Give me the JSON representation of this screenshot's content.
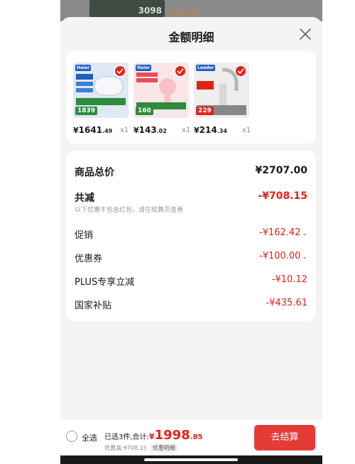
{
  "background": {
    "price_hint": "3098",
    "badge_text": "30天价保"
  },
  "sheet": {
    "title": "金额明细",
    "close_icon": "close-icon"
  },
  "products": [
    {
      "brand": "Haier",
      "tag": "1839",
      "price_symbol": "¥",
      "price_int": "1641",
      "price_dec": ".49",
      "qty": "x1",
      "image_color": "#3a7fd6",
      "image_bg": "#dfe8f5"
    },
    {
      "brand": "Haier",
      "tag": "160",
      "price_symbol": "¥",
      "price_int": "143",
      "price_dec": ".02",
      "qty": "x1",
      "image_color": "#f6c2c6",
      "image_bg": "#fbe6e7"
    },
    {
      "brand": "Leader",
      "tag": "229",
      "price_symbol": "¥",
      "price_int": "214",
      "price_dec": ".34",
      "qty": "x1",
      "image_color": "#c9c9c9",
      "image_bg": "#eeeeee"
    }
  ],
  "breakdown": {
    "total_label": "商品总价",
    "total_value": "¥2707.00",
    "minus_label": "共减",
    "minus_value": "-¥708.15",
    "note": "以下优惠不包含红包，请在结算页查看",
    "items": [
      {
        "label": "促销",
        "value": "-¥162.42",
        "expandable": true
      },
      {
        "label": "优惠券",
        "value": "-¥100.00",
        "expandable": true
      },
      {
        "label": "PLUS专享立减",
        "value": "-¥10.12",
        "expandable": false
      },
      {
        "label": "国家补贴",
        "value": "-¥435.61",
        "expandable": false
      }
    ]
  },
  "bottom_bar": {
    "select_all": "全选",
    "selected_prefix": "已选3件,合计:",
    "total_symbol": "¥",
    "total_int": "1998",
    "total_dec": ".85",
    "discount_text": "优惠减:¥708.15",
    "detail_button": "优惠明细",
    "checkout_button": "去结算"
  },
  "colors": {
    "accent": "#e2231a",
    "checkout": "#e53b37"
  }
}
